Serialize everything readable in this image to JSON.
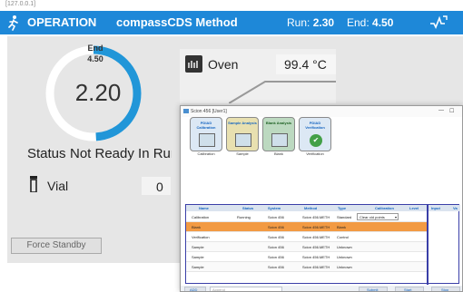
{
  "address_fragment": "[127.0.0.1]",
  "header": {
    "title": "OPERATION",
    "method": "compassCDS Method",
    "run_label": "Run:",
    "run_value": "2.30",
    "end_label": "End:",
    "end_value": "4.50",
    "icons": [
      "runner-icon",
      "signal-icon"
    ]
  },
  "gauge": {
    "end_label": "End",
    "end_value": "4.50",
    "value": "2.20",
    "progress": 0.49
  },
  "status": {
    "label": "Status",
    "value": "Not Ready In Run"
  },
  "vial": {
    "label": "Vial",
    "value": "0"
  },
  "force_standby_label": "Force Standby",
  "oven": {
    "label": "Oven",
    "temp": "99.4 °C"
  },
  "window": {
    "title": "Scion 456 [User1]",
    "min": "—",
    "max": "☐",
    "steps": [
      {
        "title": "PDIAD Calibration",
        "caption": "Calibration"
      },
      {
        "title": "Sample Analysis",
        "caption": "Sample"
      },
      {
        "title": "Blank Analysis",
        "caption": "Blank"
      },
      {
        "title": "PDIAD Verification",
        "caption": "Verification"
      }
    ],
    "columns": [
      "Name",
      "Status",
      "System",
      "Method",
      "Type",
      "Calibration",
      "Level"
    ],
    "side_columns": [
      "Input",
      "Va"
    ],
    "rows": [
      {
        "name": "Calibration",
        "status": "Running",
        "system": "Scion 456",
        "method": "Scion 456.METH",
        "type": "Standard",
        "calibration": "Clear old points"
      },
      {
        "name": "Blank",
        "status": "",
        "system": "Scion 456",
        "method": "Scion 456.METH",
        "type": "Blank",
        "calibration": ""
      },
      {
        "name": "Verification",
        "status": "",
        "system": "Scion 456",
        "method": "Scion 456.METH",
        "type": "Control",
        "calibration": ""
      },
      {
        "name": "Sample",
        "status": "",
        "system": "Scion 456",
        "method": "Scion 456.METH",
        "type": "Unknown",
        "calibration": ""
      },
      {
        "name": "Sample",
        "status": "",
        "system": "Scion 456",
        "method": "Scion 456.METH",
        "type": "Unknown",
        "calibration": ""
      },
      {
        "name": "Sample",
        "status": "",
        "system": "Scion 456",
        "method": "Scion 456.METH",
        "type": "Unknown",
        "calibration": ""
      }
    ],
    "selected_row": 1,
    "footer": {
      "add_label": "ADD",
      "append_label": "Append",
      "btn1": "Submit",
      "btn2": "Start",
      "btn3": "Stop"
    }
  },
  "colors": {
    "header": "#1e88d8",
    "gauge_arc": "#2196d8",
    "selected_row": "#f29a43",
    "grid_border": "#3a3fa8"
  }
}
